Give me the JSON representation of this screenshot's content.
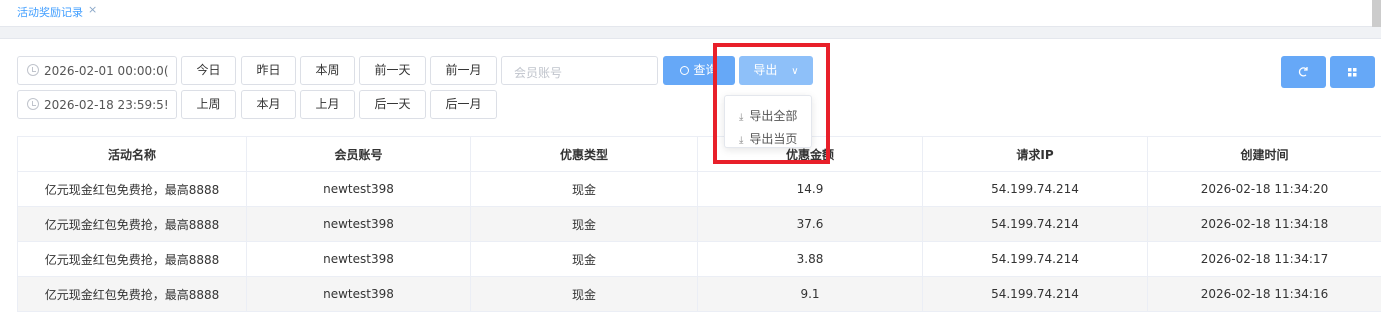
{
  "tabs": {
    "active_label": "活动奖励记录",
    "close_glyph": "×"
  },
  "filters": {
    "start_datetime": "2026-02-01 00:00:0(",
    "end_datetime": "2026-02-18 23:59:5!",
    "row1_buttons": [
      "今日",
      "昨日",
      "本周",
      "前一天",
      "前一月"
    ],
    "row2_buttons": [
      "上周",
      "本月",
      "上月",
      "后一天",
      "后一月"
    ],
    "member_placeholder": "会员账号",
    "search_label": "查询",
    "export_label": "导出",
    "export_menu": [
      "导出全部",
      "导出当页"
    ],
    "refresh_icon": "refresh-icon",
    "grid_icon": "grid-icon"
  },
  "colors": {
    "primary": "#409eff",
    "button_blue": "#66a8f7",
    "highlight": "#e8202a"
  },
  "table": {
    "headers": [
      "活动名称",
      "会员账号",
      "优惠类型",
      "优惠金额",
      "请求IP",
      "创建时间"
    ],
    "rows": [
      [
        "亿元现金红包免费抢，最高8888",
        "newtest398",
        "现金",
        "14.9",
        "54.199.74.214",
        "2026-02-18 11:34:20"
      ],
      [
        "亿元现金红包免费抢，最高8888",
        "newtest398",
        "现金",
        "37.6",
        "54.199.74.214",
        "2026-02-18 11:34:18"
      ],
      [
        "亿元现金红包免费抢，最高8888",
        "newtest398",
        "现金",
        "3.88",
        "54.199.74.214",
        "2026-02-18 11:34:17"
      ],
      [
        "亿元现金红包免费抢，最高8888",
        "newtest398",
        "现金",
        "9.1",
        "54.199.74.214",
        "2026-02-18 11:34:16"
      ]
    ]
  }
}
